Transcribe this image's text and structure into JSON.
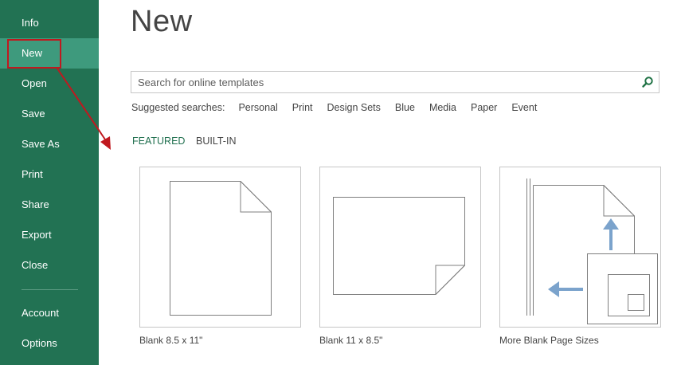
{
  "sidebar": {
    "items": [
      {
        "id": "info",
        "label": "Info"
      },
      {
        "id": "new",
        "label": "New"
      },
      {
        "id": "open",
        "label": "Open"
      },
      {
        "id": "save",
        "label": "Save"
      },
      {
        "id": "save-as",
        "label": "Save As"
      },
      {
        "id": "print",
        "label": "Print"
      },
      {
        "id": "share",
        "label": "Share"
      },
      {
        "id": "export",
        "label": "Export"
      },
      {
        "id": "close",
        "label": "Close"
      },
      {
        "id": "account",
        "label": "Account"
      },
      {
        "id": "options",
        "label": "Options"
      }
    ],
    "active": "new"
  },
  "main": {
    "title": "New",
    "search": {
      "placeholder": "Search for online templates",
      "value": "",
      "icon": "search-icon"
    },
    "suggested": {
      "label": "Suggested searches:",
      "links": [
        "Personal",
        "Print",
        "Design Sets",
        "Blue",
        "Media",
        "Paper",
        "Event"
      ]
    },
    "tabs": [
      {
        "label": "FEATURED",
        "active": true
      },
      {
        "label": "BUILT-IN",
        "active": false
      }
    ],
    "templates": [
      {
        "label": "Blank 8.5 x 11\"",
        "icon": "portrait-page-icon"
      },
      {
        "label": "Blank 11 x 8.5\"",
        "icon": "landscape-page-icon"
      },
      {
        "label": "More Blank Page Sizes",
        "icon": "page-sizes-icon"
      }
    ]
  },
  "colors": {
    "sidebar_bg": "#227253",
    "sidebar_active": "#3e9a7d",
    "annotation_red": "#c0191f",
    "accent_green": "#1f6f4e",
    "page_arrow_blue": "#7ba3cc"
  }
}
